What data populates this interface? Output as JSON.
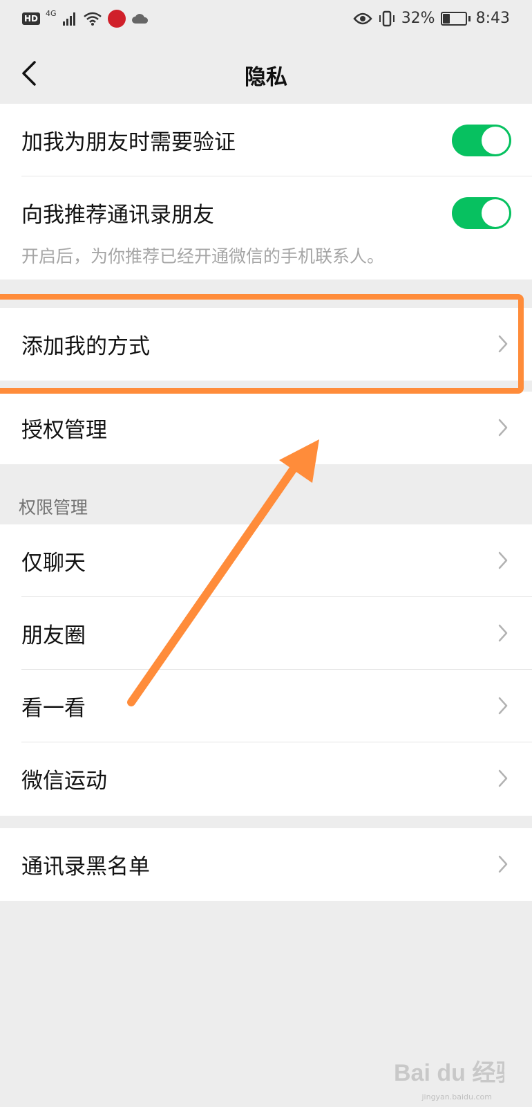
{
  "status_bar": {
    "hd": "HD",
    "network": "4G",
    "battery": "32%",
    "battery_level": 0.32,
    "time": "8:43"
  },
  "nav": {
    "back_icon": "chevron-left-icon",
    "title": "隐私"
  },
  "group1": {
    "verify_label": "加我为朋友时需要验证",
    "verify_on": true,
    "recommend_label": "向我推荐通讯录朋友",
    "recommend_on": true,
    "recommend_hint": "开启后，为你推荐已经开通微信的手机联系人。"
  },
  "group2": {
    "add_me_label": "添加我的方式",
    "authorization_label": "授权管理"
  },
  "permissions": {
    "section_title": "权限管理",
    "items": [
      "仅聊天",
      "朋友圈",
      "看一看",
      "微信运动"
    ]
  },
  "group4": {
    "blacklist_label": "通讯录黑名单"
  },
  "watermark": {
    "text": "Bai du 经验",
    "sub": "jingyan.baidu.com"
  },
  "colors": {
    "toggle_on": "#07c160",
    "annotation": "#ff8c3a",
    "background": "#ededed"
  }
}
